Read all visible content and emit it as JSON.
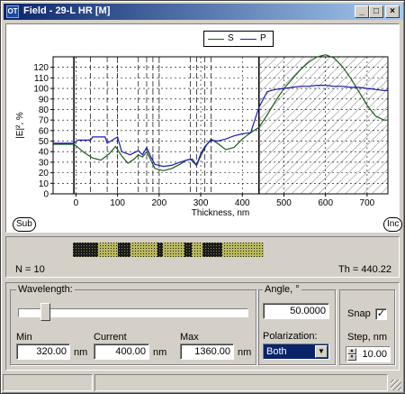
{
  "window": {
    "icon_text": "OT",
    "title": "Field - 29-L HR [M]",
    "minimize_glyph": "_",
    "maximize_glyph": "□",
    "close_glyph": "×"
  },
  "badges": {
    "sub": "Sub",
    "inc": "Inc"
  },
  "chart_data": {
    "type": "line",
    "xlabel": "Thickness, nm",
    "ylabel": "|E|², %",
    "xlim": [
      -55,
      750
    ],
    "ylim": [
      0,
      130
    ],
    "x_ticks": [
      0,
      100,
      200,
      300,
      400,
      500,
      600,
      700
    ],
    "y_ticks": [
      0,
      10,
      20,
      30,
      40,
      50,
      60,
      70,
      80,
      90,
      100,
      110,
      120
    ],
    "grid": true,
    "legend_position": "top-center",
    "substrate_region": [
      -55,
      -5
    ],
    "incident_region": [
      440,
      750
    ],
    "layer_boundaries": [
      35,
      75,
      100,
      150,
      170,
      185,
      200,
      275,
      290,
      310,
      325,
      440
    ],
    "series": [
      {
        "name": "S",
        "color": "#1a5a1a",
        "x": [
          -55,
          -5,
          5,
          20,
          40,
          60,
          80,
          95,
          110,
          125,
          140,
          150,
          160,
          170,
          180,
          190,
          210,
          230,
          250,
          265,
          280,
          290,
          300,
          315,
          325,
          340,
          360,
          380,
          400,
          420,
          440,
          460,
          480,
          500,
          520,
          540,
          560,
          580,
          600,
          620,
          640,
          660,
          680,
          700,
          720,
          740,
          750
        ],
        "values": [
          47,
          47,
          44,
          39,
          34,
          32,
          38,
          45,
          36,
          29,
          33,
          37,
          35,
          40,
          32,
          24,
          22,
          24,
          28,
          32,
          33,
          27,
          36,
          47,
          52,
          48,
          42,
          44,
          52,
          58,
          63,
          75,
          88,
          100,
          109,
          118,
          125,
          130,
          132,
          129,
          121,
          110,
          97,
          84,
          74,
          70,
          70
        ]
      },
      {
        "name": "P",
        "color": "#1a1ab0",
        "x": [
          -55,
          -5,
          5,
          35,
          40,
          70,
          75,
          100,
          110,
          130,
          150,
          160,
          170,
          180,
          190,
          210,
          230,
          250,
          275,
          285,
          290,
          300,
          310,
          325,
          340,
          360,
          380,
          400,
          420,
          440,
          460,
          480,
          500,
          520,
          540,
          560,
          580,
          600,
          620,
          640,
          660,
          680,
          700,
          720,
          740,
          750
        ],
        "values": [
          48,
          48,
          51,
          51,
          54,
          54,
          48,
          54,
          40,
          37,
          41,
          37,
          44,
          35,
          28,
          26,
          27,
          30,
          33,
          29,
          27,
          38,
          45,
          51,
          50,
          52,
          55,
          57,
          58,
          82,
          97,
          99,
          100,
          101,
          102,
          102,
          103,
          103,
          102,
          102,
          101,
          101,
          100,
          99,
          98,
          98
        ]
      }
    ]
  },
  "stack": {
    "n_label": "N = 10",
    "th_label": "Th = 440.22"
  },
  "wavelength": {
    "legend": "Wavelength:",
    "slider_fraction": 0.1,
    "min_label": "Min",
    "min_value": "320.00",
    "current_label": "Current",
    "current_value": "400.00",
    "max_label": "Max",
    "max_value": "1360.00",
    "unit": "nm"
  },
  "angle": {
    "legend": "Angle, °",
    "value": "50.0000",
    "polarization_label": "Polarization:",
    "polarization_value": "Both"
  },
  "snap": {
    "label": "Snap",
    "checked_glyph": "✓",
    "step_label": "Step, nm",
    "step_value": "10.00"
  }
}
